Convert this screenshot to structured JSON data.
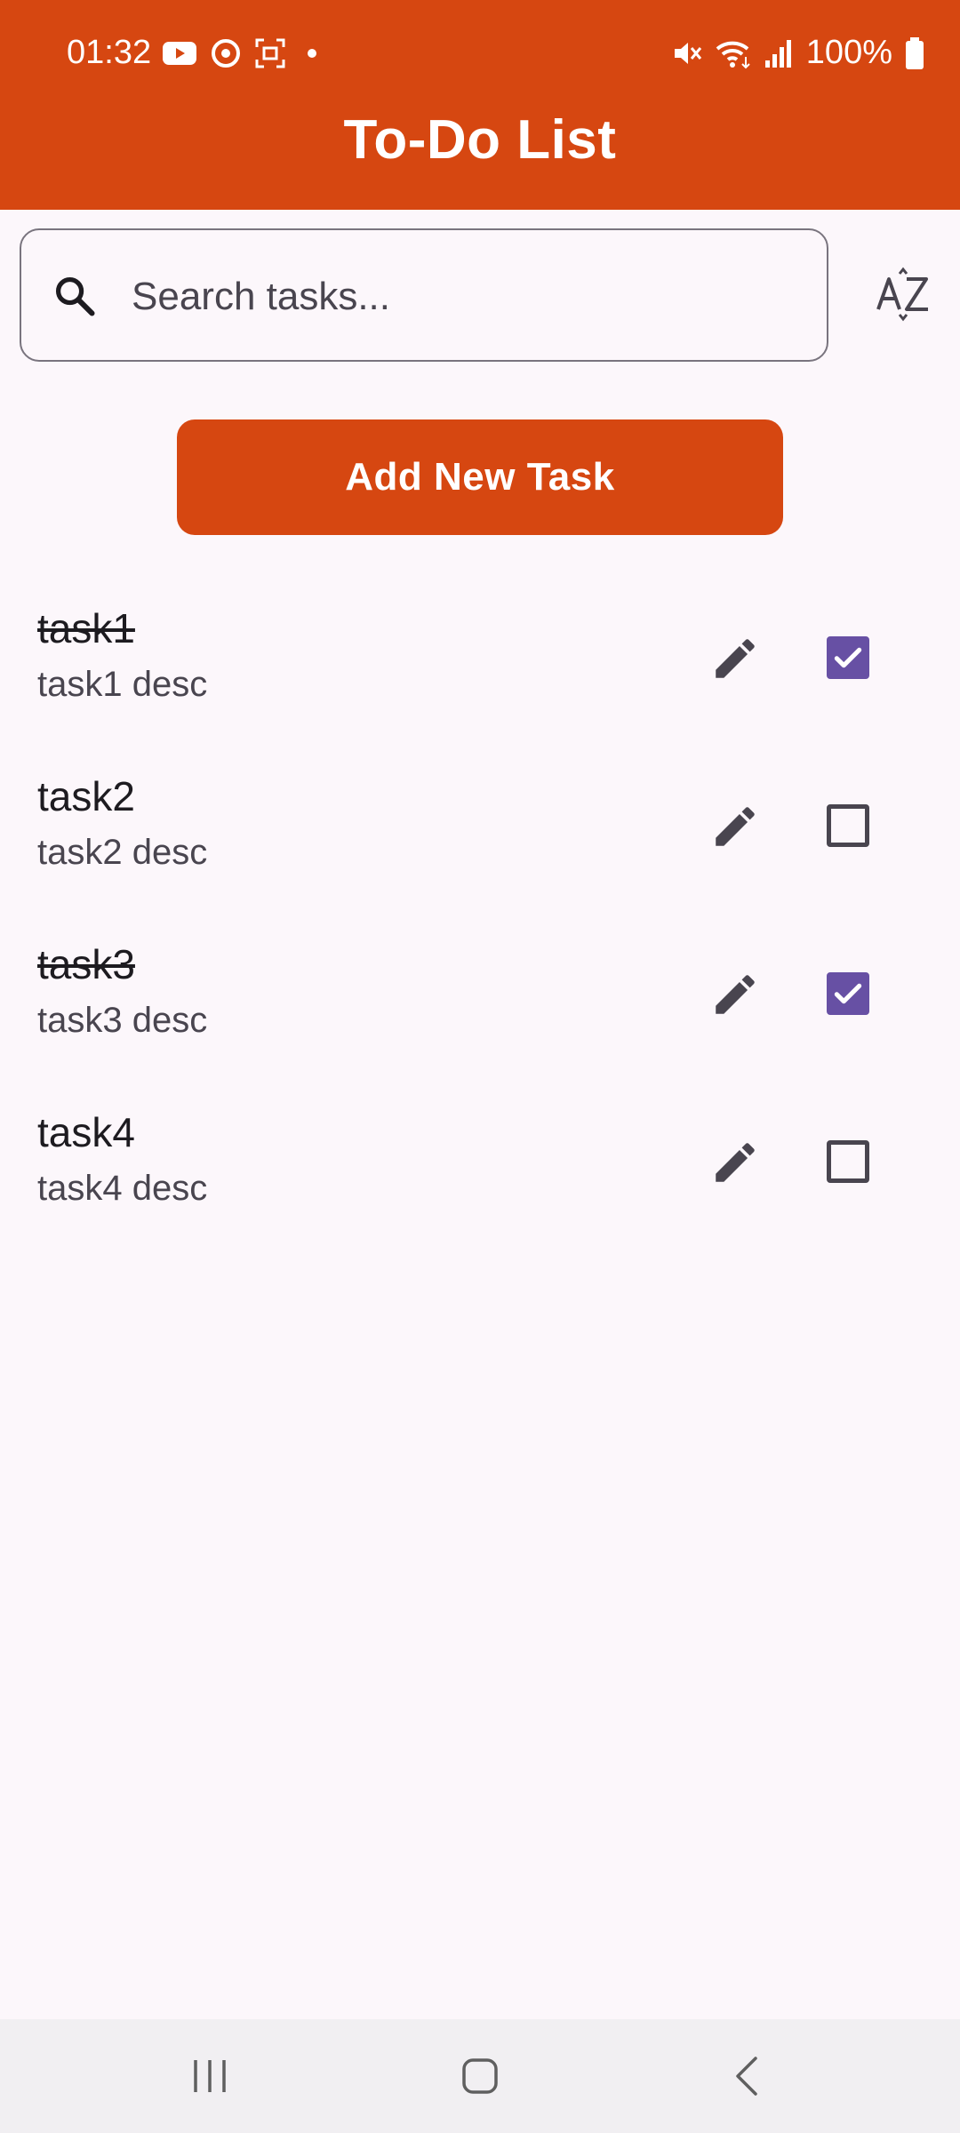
{
  "status_bar": {
    "time": "01:32",
    "battery": "100%",
    "icons": [
      "youtube-icon",
      "sync-icon",
      "screenshot-icon",
      "dot-icon",
      "mute-icon",
      "wifi-icon",
      "signal-icon",
      "battery-icon"
    ]
  },
  "app_bar": {
    "title": "To-Do List"
  },
  "search": {
    "placeholder": "Search tasks...",
    "value": ""
  },
  "sort": {
    "icon": "sort-az-icon"
  },
  "add_button": {
    "label": "Add New Task"
  },
  "tasks": [
    {
      "title": "task1",
      "description": "task1 desc",
      "done": true
    },
    {
      "title": "task2",
      "description": "task2 desc",
      "done": false
    },
    {
      "title": "task3",
      "description": "task3 desc",
      "done": true
    },
    {
      "title": "task4",
      "description": "task4 desc",
      "done": false
    }
  ],
  "nav_bar": {
    "icons": [
      "recents-icon",
      "home-icon",
      "back-icon"
    ]
  },
  "colors": {
    "primary": "#d64711",
    "checkbox": "#6750a4",
    "background": "#fcf7fb"
  }
}
